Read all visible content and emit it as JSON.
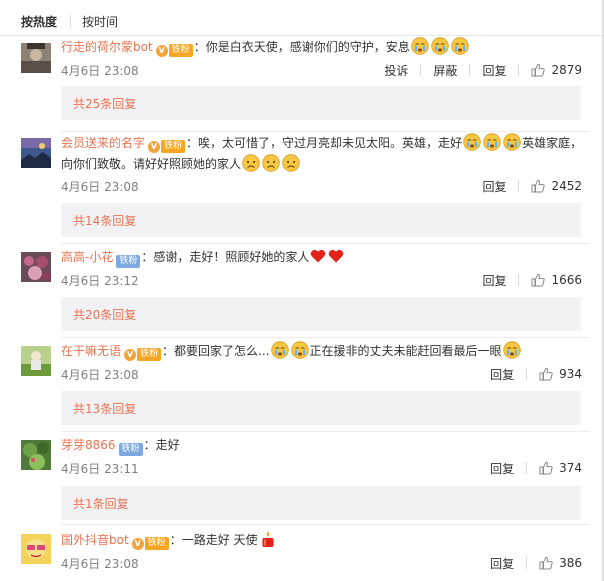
{
  "sort": {
    "hot": "按热度",
    "time": "按时间"
  },
  "badge_fan_label": "铁粉",
  "actions": {
    "report": "投诉",
    "block": "屏蔽",
    "reply": "回复"
  },
  "comments": [
    {
      "user": "行走的荷尔蒙bot",
      "sep": "：",
      "text": "你是白衣天使，感谢你们的守护，安息",
      "time": "4月6日 23:08",
      "likes": "2879",
      "replies": "共25条回复"
    },
    {
      "user": "会员送来的名字",
      "sep": "：",
      "text": "唉，太可惜了，守过月亮却未见太阳。英雄，走好",
      "text2": "英雄家庭，",
      "text3": "向你们致敬。请好好照顾她的家人",
      "time": "4月6日 23:08",
      "likes": "2452",
      "replies": "共14条回复"
    },
    {
      "user": "高高-小花",
      "sep": "：",
      "text": "感谢，走好！照顾好她的家人",
      "time": "4月6日 23:12",
      "likes": "1666",
      "replies": "共20条回复"
    },
    {
      "user": "在干嘛无语",
      "sep": "：",
      "text": "都要回家了怎么...",
      "text2": "正在援非的丈夫未能赶回看最后一眼",
      "time": "4月6日 23:08",
      "likes": "934",
      "replies": "共13条回复"
    },
    {
      "user": "芽芽8866",
      "sep": "：",
      "text": "走好",
      "time": "4月6日 23:11",
      "likes": "374",
      "replies": "共1条回复"
    },
    {
      "user": "国外抖音bot",
      "sep": "：",
      "text": "一路走好 天使",
      "time": "4月6日 23:08",
      "likes": "386"
    }
  ]
}
